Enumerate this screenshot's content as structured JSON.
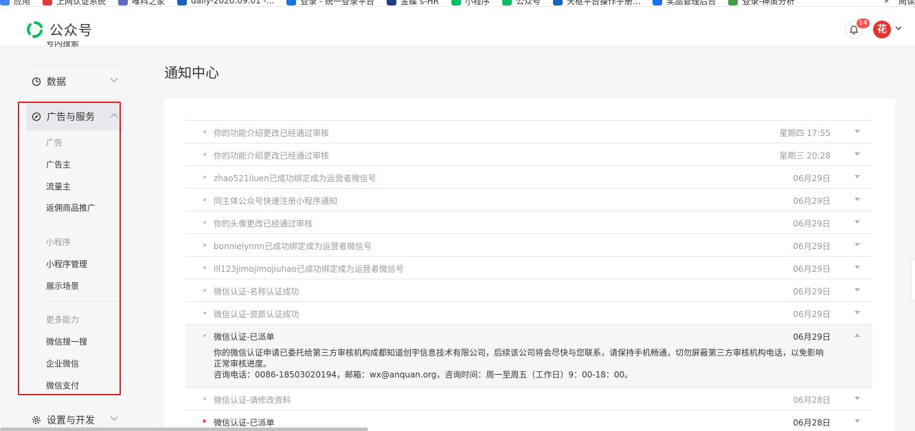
{
  "bookmarks": {
    "items": [
      {
        "label": "应用",
        "color": "#4285f4"
      },
      {
        "label": "上网认证系统",
        "color": "#e53935"
      },
      {
        "label": "唯科之家",
        "color": "#5c6bc0"
      },
      {
        "label": "daily-2020.09.01 -...",
        "color": "#1565c0"
      },
      {
        "label": "登录 - 统一登录平台",
        "color": "#1a73e8"
      },
      {
        "label": "金蝶 s-HR",
        "color": "#1e3a8a"
      },
      {
        "label": "小程序",
        "color": "#07c160"
      },
      {
        "label": "公众号",
        "color": "#07c160"
      },
      {
        "label": "天枢平台操作手册...",
        "color": "#1565c0"
      },
      {
        "label": "奖品管理后台",
        "color": "#1a73e8"
      },
      {
        "label": "登录-神策分析",
        "color": "#43a047"
      }
    ],
    "more": "»",
    "reading_list": "阅读"
  },
  "header": {
    "logo_text": "公众号",
    "notification_count": "14",
    "avatar_text": "花"
  },
  "sidebar": {
    "cut_item": "号内搜索",
    "groups": {
      "data": "数据",
      "ads": "广告与服务",
      "settings": "设置与开发"
    },
    "ads_section": {
      "heading": "广告",
      "items": [
        "广告主",
        "流量主",
        "返佣商品推广"
      ]
    },
    "miniprogram_section": {
      "heading": "小程序",
      "items": [
        "小程序管理",
        "展示场景"
      ]
    },
    "more_section": {
      "heading": "更多能力",
      "items": [
        "微信搜一搜",
        "企业微信",
        "微信支付"
      ]
    }
  },
  "main": {
    "page_title": "通知中心",
    "notifications": [
      {
        "title": "你的功能介绍更改已经通过审核",
        "date": "星期四 17:55"
      },
      {
        "title": "你的功能介绍更改已经通过审核",
        "date": "星期三 20:28"
      },
      {
        "title": "zhao521liuen已成功绑定成为运营者微信号",
        "date": "06月29日"
      },
      {
        "title": "同主体公众号快速注册小程序通知",
        "date": "06月29日"
      },
      {
        "title": "你的头像更改已经通过审核",
        "date": "06月29日"
      },
      {
        "title": "bonnielynnn已成功绑定成为运营者微信号",
        "date": "06月29日"
      },
      {
        "title": "lll123jimojimojiuhao已成功绑定成为运营者微信号",
        "date": "06月29日"
      },
      {
        "title": "微信认证-名称认证成功",
        "date": "06月29日"
      },
      {
        "title": "微信认证-资质认证成功",
        "date": "06月29日"
      }
    ],
    "expanded": {
      "title": "微信认证-已派单",
      "date": "06月29日",
      "line1": "你的微信认证申请已委托给第三方审核机构成都知道创宇信息技术有限公司，后续该公司将会尽快与您联系，请保持手机畅通，切勿屏蔽第三方审核机构电话，以免影响正常审核进度。",
      "line2": "咨询电话：0086-18503020194，邮箱：wx@anquan.org，咨询时间：周一至周五（工作日）9：00-18：00。"
    },
    "after": [
      {
        "title": "微信认证-请修改资料",
        "date": "06月28日"
      }
    ],
    "unread": {
      "title": "微信认证-已派单",
      "date": "06月28日"
    }
  },
  "colors": {
    "accent_green": "#07c160",
    "badge_red": "#fa5151",
    "highlight_border": "#e02020"
  }
}
